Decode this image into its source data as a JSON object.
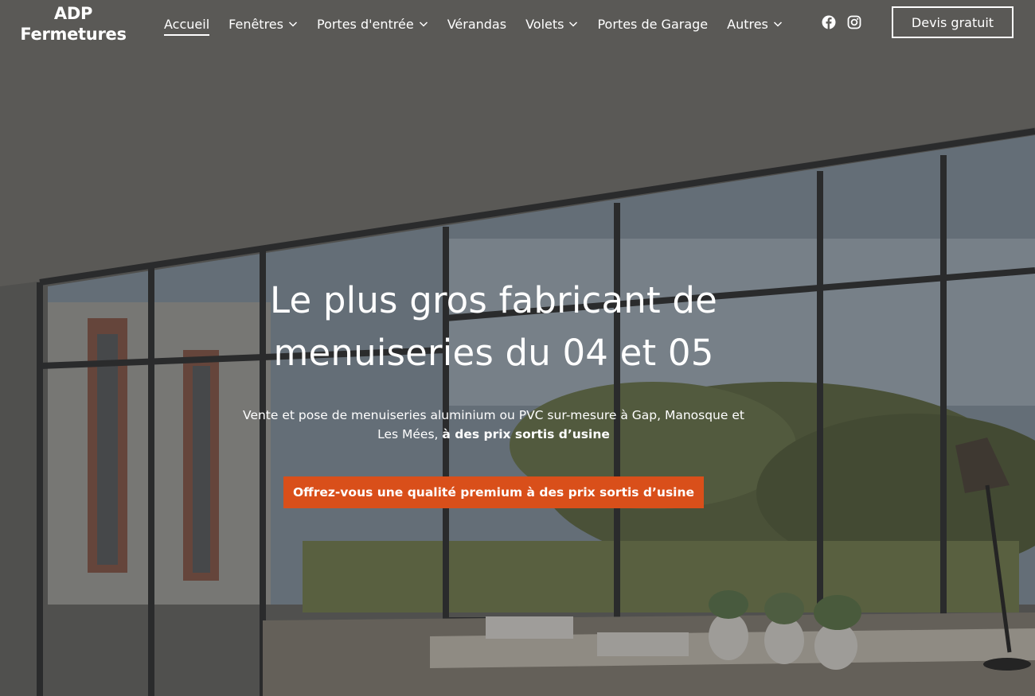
{
  "logo": {
    "line1": "ADP",
    "line2": "Fermetures"
  },
  "nav": {
    "items": [
      {
        "label": "Accueil",
        "dropdown": false,
        "active": true
      },
      {
        "label": "Fenêtres",
        "dropdown": true,
        "active": false
      },
      {
        "label": "Portes d'entrée",
        "dropdown": true,
        "active": false
      },
      {
        "label": "Vérandas",
        "dropdown": false,
        "active": false
      },
      {
        "label": "Volets",
        "dropdown": true,
        "active": false
      },
      {
        "label": "Portes de Garage",
        "dropdown": false,
        "active": false
      },
      {
        "label": "Autres",
        "dropdown": true,
        "active": false
      }
    ]
  },
  "social": {
    "icons": [
      "facebook-icon",
      "instagram-icon"
    ]
  },
  "header_cta": {
    "label": "Devis gratuit"
  },
  "hero": {
    "headline_line1": "Le plus gros fabricant de",
    "headline_line2": "menuiseries du 04 et 05",
    "subline_text": "Vente et pose de menuiseries aluminium ou PVC sur-mesure à Gap, Manosque et Les Mées,",
    "subline_bold": "à des prix sortis d’usine",
    "cta_label": "Offrez-vous une qualité premium à des prix sortis d’usine"
  },
  "colors": {
    "accent": "#d94f1a",
    "text": "#ffffff"
  }
}
